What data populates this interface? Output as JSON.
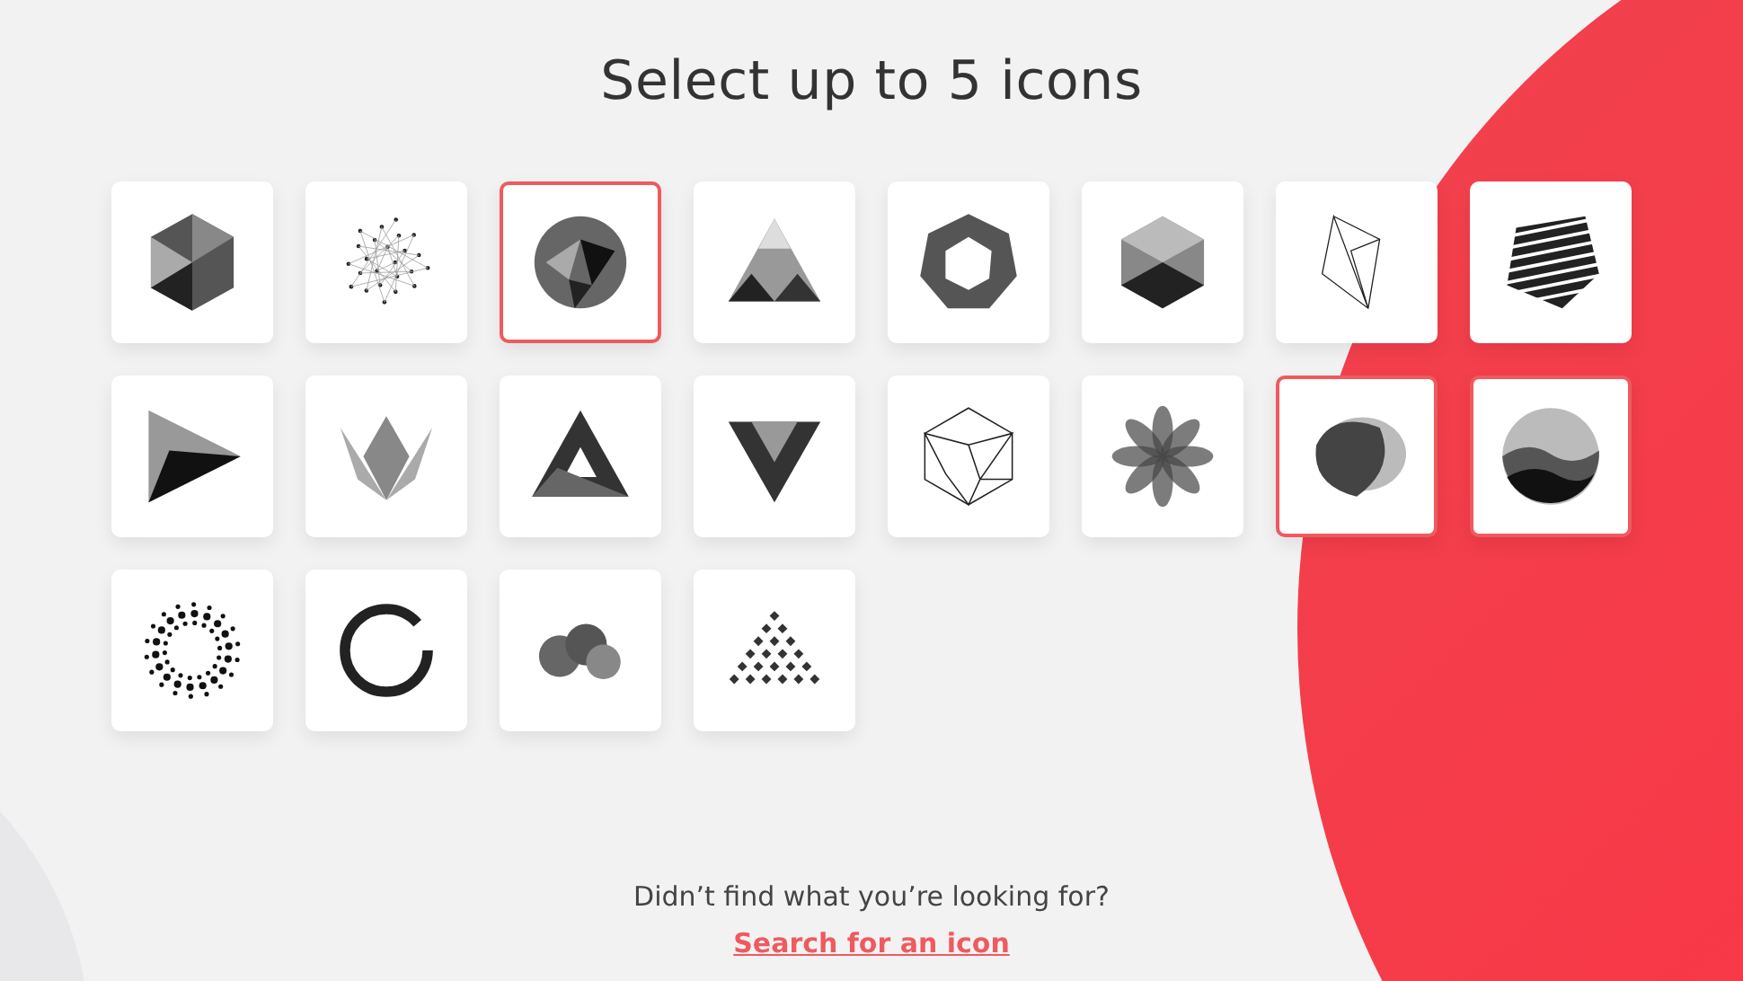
{
  "title": "Select up to 5 icons",
  "icons": [
    {
      "kind": "hexagon",
      "selected": false
    },
    {
      "kind": "network",
      "selected": false
    },
    {
      "kind": "facet-circle",
      "selected": true
    },
    {
      "kind": "triangle",
      "selected": false
    },
    {
      "kind": "ring",
      "selected": false
    },
    {
      "kind": "cube",
      "selected": false
    },
    {
      "kind": "wire",
      "selected": false
    },
    {
      "kind": "stripes",
      "selected": false
    },
    {
      "kind": "play",
      "selected": false
    },
    {
      "kind": "lotus",
      "selected": false
    },
    {
      "kind": "triangle-ring",
      "selected": false
    },
    {
      "kind": "gem",
      "selected": false
    },
    {
      "kind": "icosa",
      "selected": false
    },
    {
      "kind": "flower",
      "selected": false
    },
    {
      "kind": "blob",
      "selected": true
    },
    {
      "kind": "waves",
      "selected": true
    },
    {
      "kind": "dot-ring",
      "selected": false
    },
    {
      "kind": "brush-ring",
      "selected": false
    },
    {
      "kind": "clouds",
      "selected": false
    },
    {
      "kind": "diamond-grid",
      "selected": false
    }
  ],
  "footer": {
    "text": "Didn’t find what you’re looking for?",
    "link": "Search for an icon"
  }
}
